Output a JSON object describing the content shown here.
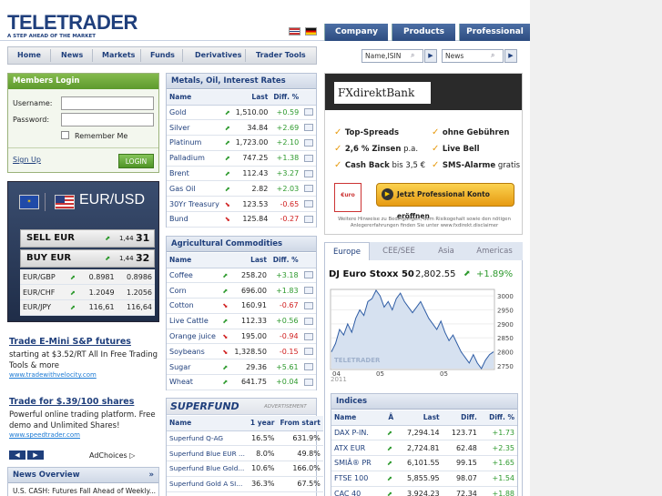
{
  "brand": {
    "logo": "TELETRADER",
    "tagline": "A STEP AHEAD OF THE MARKET"
  },
  "top_tabs": [
    "Company",
    "Products",
    "Professional"
  ],
  "nav": [
    "Home",
    "News",
    "Markets",
    "Funds",
    "Derivatives",
    "Trader Tools"
  ],
  "search": {
    "placeholder1": "Name,ISIN",
    "placeholder2": "News"
  },
  "login": {
    "title": "Members Login",
    "username": "Username:",
    "password": "Password:",
    "remember": "Remember Me",
    "signup": "Sign Up",
    "button": "LOGIN"
  },
  "fx": {
    "pair": "EUR/USD",
    "sell": "SELL EUR",
    "buy": "BUY EUR",
    "sell_small": "1,44",
    "sell_big": "31",
    "buy_small": "1,44",
    "buy_big": "32",
    "rows": [
      [
        "EUR/GBP",
        "0.8981",
        "0.8986"
      ],
      [
        "EUR/CHF",
        "1.2049",
        "1.2056"
      ],
      [
        "EUR/JPY",
        "116,61",
        "116,64"
      ]
    ]
  },
  "ads": [
    {
      "title": "Trade E-Mini S&P futures",
      "text": "starting at $3.52/RT All In Free Trading Tools & more",
      "url": "www.tradewithvelocity.com"
    },
    {
      "title": "Trade for $.39/100 shares",
      "text": "Powerful online trading platform. Free demo and Unlimited Shares!",
      "url": "www.speedtrader.com"
    }
  ],
  "adchoices": "AdChoices",
  "news_overview": {
    "title": "News Overview",
    "text": "U.S. CASH: Futures Fall Ahead of Weekly..."
  },
  "metals": {
    "title": "Metals, Oil, Interest Rates",
    "headers": [
      "Name",
      "Last",
      "Diff. %"
    ],
    "rows": [
      [
        "Gold",
        "up",
        "1,510.00",
        "+0.59",
        "pos"
      ],
      [
        "Silver",
        "up",
        "34.84",
        "+2.69",
        "pos"
      ],
      [
        "Platinum",
        "up",
        "1,723.00",
        "+2.10",
        "pos"
      ],
      [
        "Palladium",
        "up",
        "747.25",
        "+1.38",
        "pos"
      ],
      [
        "Brent",
        "up",
        "112.43",
        "+3.27",
        "pos"
      ],
      [
        "Gas Oil",
        "up",
        "2.82",
        "+2.03",
        "pos"
      ],
      [
        "30Yr Treasury",
        "dn",
        "123.53",
        "-0.65",
        "neg"
      ],
      [
        "Bund",
        "dn",
        "125.84",
        "-0.27",
        "neg"
      ]
    ]
  },
  "agri": {
    "title": "Agricultural Commodities",
    "headers": [
      "Name",
      "Last",
      "Diff. %"
    ],
    "rows": [
      [
        "Coffee",
        "up",
        "258.20",
        "+3.18",
        "pos"
      ],
      [
        "Corn",
        "up",
        "696.00",
        "+1.83",
        "pos"
      ],
      [
        "Cotton",
        "dn",
        "160.91",
        "-0.67",
        "neg"
      ],
      [
        "Live Cattle",
        "up",
        "112.33",
        "+0.56",
        "pos"
      ],
      [
        "Orange juice",
        "dn",
        "195.00",
        "-0.94",
        "neg"
      ],
      [
        "Soybeans",
        "dn",
        "1,328.50",
        "-0.15",
        "neg"
      ],
      [
        "Sugar",
        "up",
        "29.36",
        "+5.61",
        "pos"
      ],
      [
        "Wheat",
        "up",
        "641.75",
        "+0.04",
        "pos"
      ]
    ]
  },
  "superfund": {
    "logo": "SUPERFUND",
    "adv": "ADVERTISEMENT",
    "headers": [
      "Name",
      "1 year",
      "From start"
    ],
    "rows": [
      [
        "Superfund Q-AG",
        "16.5%",
        "631.9%"
      ],
      [
        "Superfund Blue EUR ...",
        "8.0%",
        "49.8%"
      ],
      [
        "Superfund Blue Gold...",
        "10.6%",
        "166.0%"
      ],
      [
        "Superfund Gold A SI...",
        "36.3%",
        "67.5%"
      ]
    ]
  },
  "fxbank": {
    "brand": "FXdirektBank",
    "features": [
      [
        "Top-Spreads",
        ""
      ],
      [
        "ohne Gebühren",
        ""
      ],
      [
        "2,6 % Zinsen",
        " p.a."
      ],
      [
        "Live Bell",
        ""
      ],
      [
        "Cash Back",
        " bis 3,5 €"
      ],
      [
        "SMS-Alarme",
        " gratis"
      ]
    ],
    "cta": "Jetzt Professional Konto eröffnen",
    "disclaimer": "Weitere Hinweise zu Bedingungen, dem Risikogehalt sowie den nötigen Anlegererfahrungen finden Sie unter www.fxdirekt.disclaimer",
    "euro_label": "€uro"
  },
  "market_tabs": [
    "Europe",
    "CEE/SEE",
    "Asia",
    "Americas"
  ],
  "index_head": {
    "name": "DJ Euro Stoxx 50",
    "value": "2,802.55",
    "change": "+1.89%"
  },
  "chart_data": {
    "type": "line",
    "x": [
      0,
      1,
      2,
      3,
      4,
      5,
      6,
      7,
      8,
      9,
      10,
      11,
      12,
      13,
      14,
      15,
      16,
      17,
      18,
      19,
      20,
      21,
      22,
      23,
      24,
      25,
      26,
      27,
      28,
      29,
      30,
      31,
      32,
      33,
      34,
      35,
      36,
      37,
      38,
      39,
      40
    ],
    "values": [
      2800,
      2830,
      2880,
      2860,
      2900,
      2870,
      2920,
      2950,
      2930,
      2980,
      2990,
      3020,
      3000,
      2960,
      2980,
      2950,
      2990,
      3010,
      2980,
      2960,
      2940,
      2960,
      2980,
      2950,
      2920,
      2900,
      2880,
      2910,
      2870,
      2840,
      2860,
      2830,
      2800,
      2780,
      2760,
      2790,
      2760,
      2740,
      2770,
      2790,
      2800
    ],
    "ylim": [
      2740,
      3020
    ],
    "yticks": [
      "3000",
      "2950",
      "2900",
      "2850",
      "2800",
      "2750"
    ],
    "xticks": [
      "04",
      "05",
      "05"
    ],
    "year": "2011",
    "watermark": "TELETRADER"
  },
  "indices": {
    "title": "Indices",
    "headers": [
      "Name",
      "Â",
      "Last",
      "Diff.",
      "Diff. %"
    ],
    "rows": [
      [
        "DAX P-IN.",
        "7,294.14",
        "123.71",
        "+1.73"
      ],
      [
        "ATX EUR",
        "2,724.81",
        "62.48",
        "+2.35"
      ],
      [
        "SMIÂ® PR",
        "6,101.55",
        "99.15",
        "+1.65"
      ],
      [
        "FTSE 100",
        "5,855.95",
        "98.07",
        "+1.54"
      ],
      [
        "CAC 40",
        "3,924.23",
        "72.34",
        "+1.88"
      ]
    ]
  }
}
